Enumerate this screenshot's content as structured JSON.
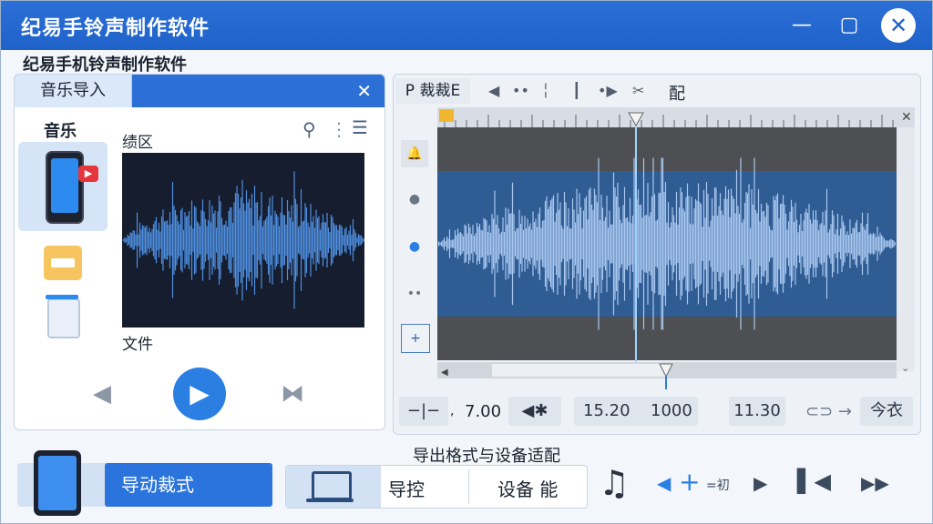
{
  "window": {
    "title": "纪易手铃声制作软件",
    "subtitle": "纪易手机铃声制作软件"
  },
  "left_panel": {
    "tab": "音乐导入",
    "category_label": "音乐",
    "preview_label": "绩区",
    "file_label": "文件"
  },
  "editor": {
    "tab": "P 裁裁E",
    "label": "配",
    "time": {
      "start_value": "7.00",
      "prefix_mark": ",",
      "current": "15.20",
      "total": "1000",
      "end": "11.30",
      "mode": "今衣"
    }
  },
  "bottom": {
    "section_title": "导出格式与设备适配",
    "active_option": "导动裁式",
    "control_option": "导控",
    "device_option": "设备  能",
    "ctrl_label": "=",
    "ctrl_sub": "初"
  },
  "colors": {
    "accent": "#2b74dd",
    "titlebar": "#1f62c9",
    "waveform": "#5b9ae8"
  }
}
